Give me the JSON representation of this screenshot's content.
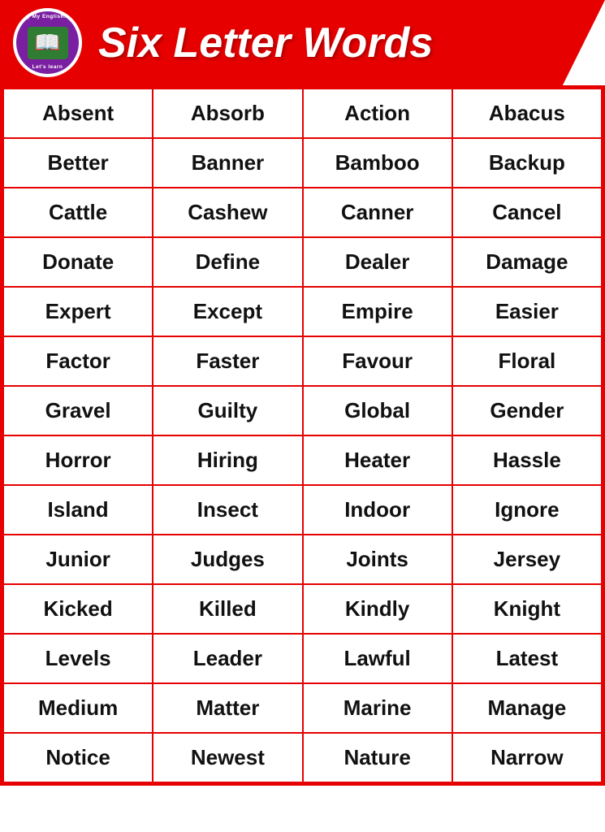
{
  "header": {
    "title": "Six Letter Words",
    "logo": {
      "top_text": "Only My English.com",
      "bottom_text": "Let's learn"
    }
  },
  "table": {
    "rows": [
      [
        "Absent",
        "Absorb",
        "Action",
        "Abacus"
      ],
      [
        "Better",
        "Banner",
        "Bamboo",
        "Backup"
      ],
      [
        "Cattle",
        "Cashew",
        "Canner",
        "Cancel"
      ],
      [
        "Donate",
        "Define",
        "Dealer",
        "Damage"
      ],
      [
        "Expert",
        "Except",
        "Empire",
        "Easier"
      ],
      [
        "Factor",
        "Faster",
        "Favour",
        "Floral"
      ],
      [
        "Gravel",
        "Guilty",
        "Global",
        "Gender"
      ],
      [
        "Horror",
        "Hiring",
        "Heater",
        "Hassle"
      ],
      [
        "Island",
        "Insect",
        "Indoor",
        "Ignore"
      ],
      [
        "Junior",
        "Judges",
        "Joints",
        "Jersey"
      ],
      [
        "Kicked",
        "Killed",
        "Kindly",
        "Knight"
      ],
      [
        "Levels",
        "Leader",
        "Lawful",
        "Latest"
      ],
      [
        "Medium",
        "Matter",
        "Marine",
        "Manage"
      ],
      [
        "Notice",
        "Newest",
        "Nature",
        "Narrow"
      ]
    ]
  },
  "colors": {
    "red": "#e60000",
    "purple": "#7b1fa2",
    "green": "#2e7d32",
    "white": "#ffffff",
    "black": "#111111"
  }
}
